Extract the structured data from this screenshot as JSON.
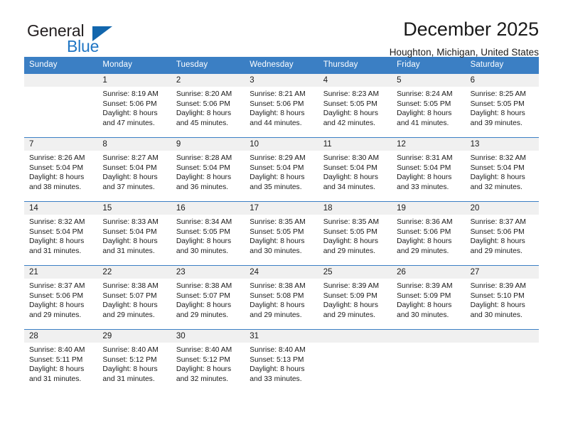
{
  "brand": {
    "name_part1": "General",
    "name_part2": "Blue",
    "triangle_color": "#1266ad",
    "blue_color": "#2076c4"
  },
  "header": {
    "month_title": "December 2025",
    "location": "Houghton, Michigan, United States",
    "header_bg_color": "#3b7fc4"
  },
  "weekdays": [
    {
      "label": "Sunday"
    },
    {
      "label": "Monday"
    },
    {
      "label": "Tuesday"
    },
    {
      "label": "Wednesday"
    },
    {
      "label": "Thursday"
    },
    {
      "label": "Friday"
    },
    {
      "label": "Saturday"
    }
  ],
  "weeks": [
    [
      {
        "day": "",
        "info": ""
      },
      {
        "day": "1",
        "info": "Sunrise: 8:19 AM\nSunset: 5:06 PM\nDaylight: 8 hours\nand 47 minutes."
      },
      {
        "day": "2",
        "info": "Sunrise: 8:20 AM\nSunset: 5:06 PM\nDaylight: 8 hours\nand 45 minutes."
      },
      {
        "day": "3",
        "info": "Sunrise: 8:21 AM\nSunset: 5:06 PM\nDaylight: 8 hours\nand 44 minutes."
      },
      {
        "day": "4",
        "info": "Sunrise: 8:23 AM\nSunset: 5:05 PM\nDaylight: 8 hours\nand 42 minutes."
      },
      {
        "day": "5",
        "info": "Sunrise: 8:24 AM\nSunset: 5:05 PM\nDaylight: 8 hours\nand 41 minutes."
      },
      {
        "day": "6",
        "info": "Sunrise: 8:25 AM\nSunset: 5:05 PM\nDaylight: 8 hours\nand 39 minutes."
      }
    ],
    [
      {
        "day": "7",
        "info": "Sunrise: 8:26 AM\nSunset: 5:04 PM\nDaylight: 8 hours\nand 38 minutes."
      },
      {
        "day": "8",
        "info": "Sunrise: 8:27 AM\nSunset: 5:04 PM\nDaylight: 8 hours\nand 37 minutes."
      },
      {
        "day": "9",
        "info": "Sunrise: 8:28 AM\nSunset: 5:04 PM\nDaylight: 8 hours\nand 36 minutes."
      },
      {
        "day": "10",
        "info": "Sunrise: 8:29 AM\nSunset: 5:04 PM\nDaylight: 8 hours\nand 35 minutes."
      },
      {
        "day": "11",
        "info": "Sunrise: 8:30 AM\nSunset: 5:04 PM\nDaylight: 8 hours\nand 34 minutes."
      },
      {
        "day": "12",
        "info": "Sunrise: 8:31 AM\nSunset: 5:04 PM\nDaylight: 8 hours\nand 33 minutes."
      },
      {
        "day": "13",
        "info": "Sunrise: 8:32 AM\nSunset: 5:04 PM\nDaylight: 8 hours\nand 32 minutes."
      }
    ],
    [
      {
        "day": "14",
        "info": "Sunrise: 8:32 AM\nSunset: 5:04 PM\nDaylight: 8 hours\nand 31 minutes."
      },
      {
        "day": "15",
        "info": "Sunrise: 8:33 AM\nSunset: 5:04 PM\nDaylight: 8 hours\nand 31 minutes."
      },
      {
        "day": "16",
        "info": "Sunrise: 8:34 AM\nSunset: 5:05 PM\nDaylight: 8 hours\nand 30 minutes."
      },
      {
        "day": "17",
        "info": "Sunrise: 8:35 AM\nSunset: 5:05 PM\nDaylight: 8 hours\nand 30 minutes."
      },
      {
        "day": "18",
        "info": "Sunrise: 8:35 AM\nSunset: 5:05 PM\nDaylight: 8 hours\nand 29 minutes."
      },
      {
        "day": "19",
        "info": "Sunrise: 8:36 AM\nSunset: 5:06 PM\nDaylight: 8 hours\nand 29 minutes."
      },
      {
        "day": "20",
        "info": "Sunrise: 8:37 AM\nSunset: 5:06 PM\nDaylight: 8 hours\nand 29 minutes."
      }
    ],
    [
      {
        "day": "21",
        "info": "Sunrise: 8:37 AM\nSunset: 5:06 PM\nDaylight: 8 hours\nand 29 minutes."
      },
      {
        "day": "22",
        "info": "Sunrise: 8:38 AM\nSunset: 5:07 PM\nDaylight: 8 hours\nand 29 minutes."
      },
      {
        "day": "23",
        "info": "Sunrise: 8:38 AM\nSunset: 5:07 PM\nDaylight: 8 hours\nand 29 minutes."
      },
      {
        "day": "24",
        "info": "Sunrise: 8:38 AM\nSunset: 5:08 PM\nDaylight: 8 hours\nand 29 minutes."
      },
      {
        "day": "25",
        "info": "Sunrise: 8:39 AM\nSunset: 5:09 PM\nDaylight: 8 hours\nand 29 minutes."
      },
      {
        "day": "26",
        "info": "Sunrise: 8:39 AM\nSunset: 5:09 PM\nDaylight: 8 hours\nand 30 minutes."
      },
      {
        "day": "27",
        "info": "Sunrise: 8:39 AM\nSunset: 5:10 PM\nDaylight: 8 hours\nand 30 minutes."
      }
    ],
    [
      {
        "day": "28",
        "info": "Sunrise: 8:40 AM\nSunset: 5:11 PM\nDaylight: 8 hours\nand 31 minutes."
      },
      {
        "day": "29",
        "info": "Sunrise: 8:40 AM\nSunset: 5:12 PM\nDaylight: 8 hours\nand 31 minutes."
      },
      {
        "day": "30",
        "info": "Sunrise: 8:40 AM\nSunset: 5:12 PM\nDaylight: 8 hours\nand 32 minutes."
      },
      {
        "day": "31",
        "info": "Sunrise: 8:40 AM\nSunset: 5:13 PM\nDaylight: 8 hours\nand 33 minutes."
      },
      {
        "day": "",
        "info": ""
      },
      {
        "day": "",
        "info": ""
      },
      {
        "day": "",
        "info": ""
      }
    ]
  ]
}
